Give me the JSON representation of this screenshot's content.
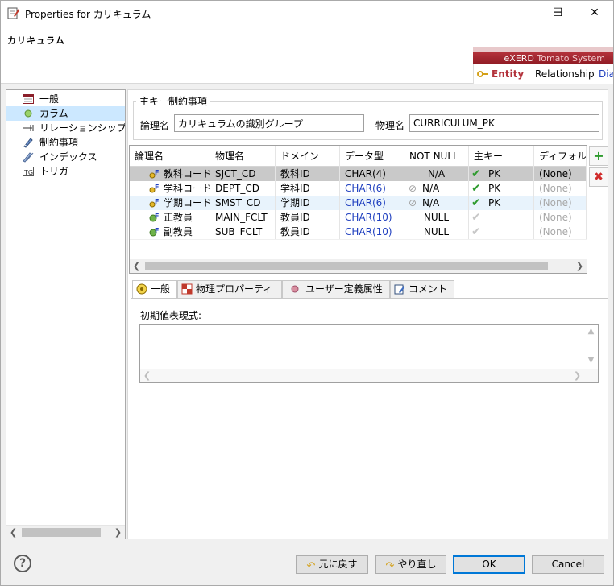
{
  "window": {
    "title": "Properties for カリキュラム",
    "controls": {
      "minimize": "─",
      "maximize": "☐",
      "close": "✕"
    }
  },
  "header": {
    "page_title": "カリキュラム",
    "banner": {
      "brand": "eXERD",
      "brand_sub": "Tomato System",
      "tabs": [
        "Entity",
        "Relationship",
        "Diag"
      ]
    }
  },
  "tree": {
    "items": [
      {
        "label": "一般",
        "icon": "general-icon"
      },
      {
        "label": "カラム",
        "icon": "column-icon",
        "selected": true
      },
      {
        "label": "リレーションシップ",
        "icon": "relationship-icon"
      },
      {
        "label": "制約事項",
        "icon": "constraint-icon"
      },
      {
        "label": "インデックス",
        "icon": "index-icon"
      },
      {
        "label": "トリガ",
        "icon": "trigger-icon"
      }
    ]
  },
  "pk_group": {
    "title": "主キー制約事項",
    "logical_label": "論理名",
    "logical_value": "カリキュラムの識別グループ",
    "physical_label": "物理名",
    "physical_value": "CURRICULUM_PK"
  },
  "grid": {
    "columns": [
      "論理名",
      "物理名",
      "ドメイン",
      "データ型",
      "NOT NULL",
      "主キー",
      "ディフォル"
    ],
    "rows": [
      {
        "logical": "教科コード",
        "physical": "SJCT_CD",
        "domain": "教科ID",
        "type": "CHAR(4)",
        "notnull": "N/A",
        "pk": "PK",
        "default": "(None)",
        "kind": "fk-pk",
        "state": "selected"
      },
      {
        "logical": "学科コード",
        "physical": "DEPT_CD",
        "domain": "学科ID",
        "type": "CHAR(6)",
        "notnull": "N/A",
        "pk": "PK",
        "default": "(None)",
        "kind": "fk-pk",
        "state": "normal"
      },
      {
        "logical": "学期コード",
        "physical": "SMST_CD",
        "domain": "学期ID",
        "type": "CHAR(6)",
        "notnull": "N/A",
        "pk": "PK",
        "default": "(None)",
        "kind": "fk-pk",
        "state": "alt"
      },
      {
        "logical": "正教員",
        "physical": "MAIN_FCLT",
        "domain": "教員ID",
        "type": "CHAR(10)",
        "notnull": "NULL",
        "pk": "",
        "default": "(None)",
        "kind": "fk",
        "state": "normal"
      },
      {
        "logical": "副教員",
        "physical": "SUB_FCLT",
        "domain": "教員ID",
        "type": "CHAR(10)",
        "notnull": "NULL",
        "pk": "",
        "default": "(None)",
        "kind": "fk",
        "state": "normal"
      }
    ],
    "add_button": "+",
    "delete_button": "✖"
  },
  "prop_tabs": [
    {
      "label": "一般",
      "icon": "general-tab-icon",
      "active": true
    },
    {
      "label": "物理プロパーティ",
      "icon": "physical-tab-icon"
    },
    {
      "label": "ユーザー定義属性",
      "icon": "user-attr-tab-icon"
    },
    {
      "label": "コメント",
      "icon": "comment-tab-icon"
    }
  ],
  "initial_expr": {
    "label": "初期値表現式:",
    "value": ""
  },
  "footer": {
    "help": "?",
    "revert": "元に戻す",
    "redo": "やり直し",
    "ok": "OK",
    "cancel": "Cancel"
  },
  "colors": {
    "accent": "#0078d7",
    "banner_red": "#a0262f",
    "selection": "#cce8ff",
    "type_blue": "#1f3fbf"
  }
}
